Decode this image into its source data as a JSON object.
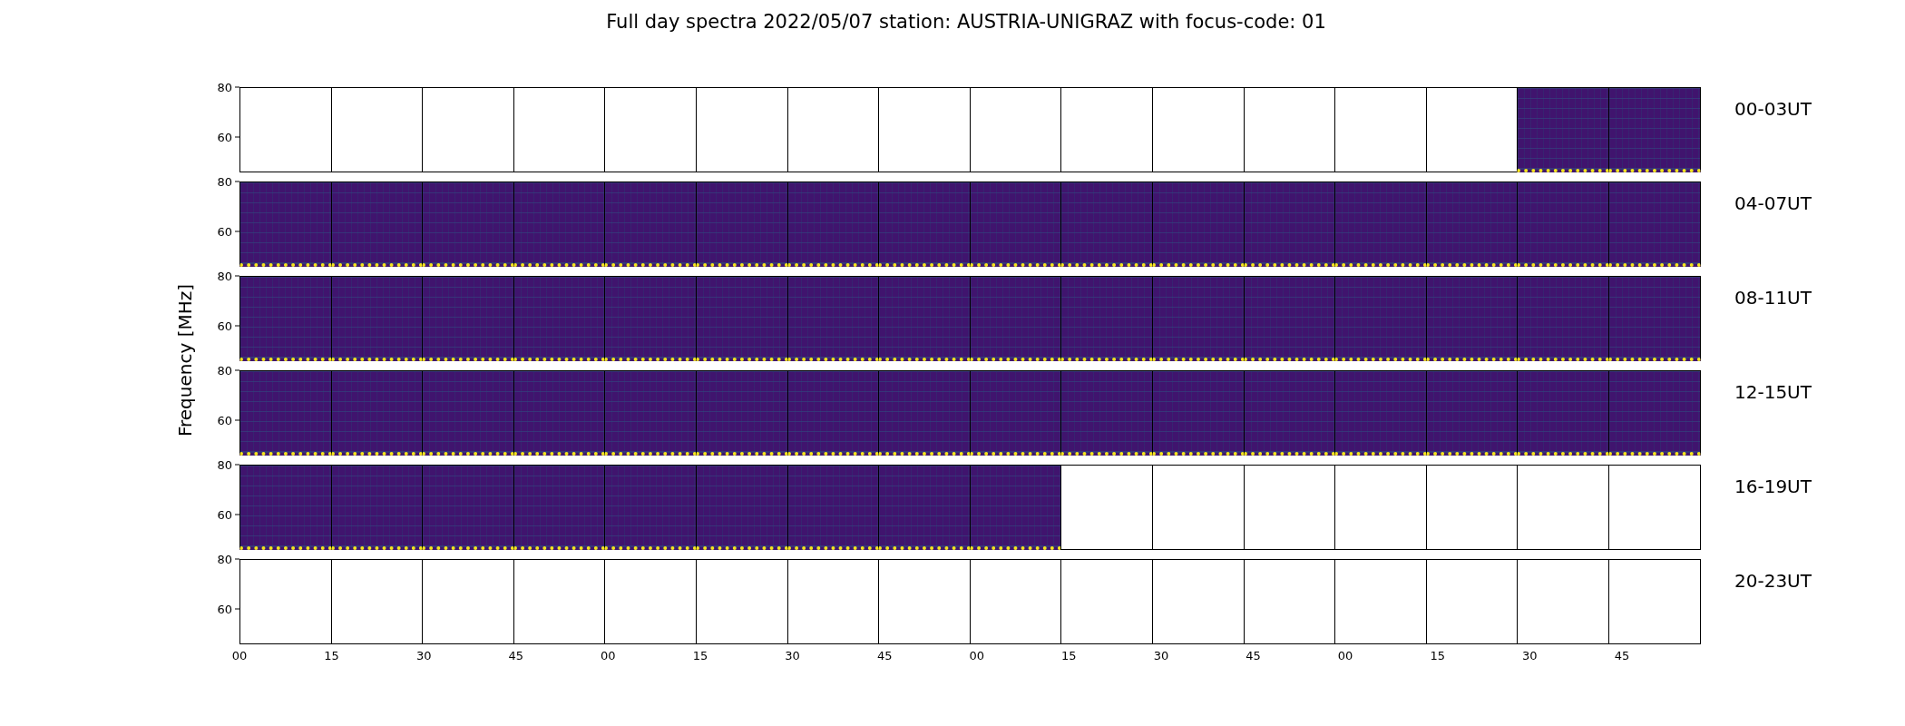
{
  "title": "Full day spectra 2022/05/07 station: AUSTRIA-UNIGRAZ with focus-code: 01",
  "y_axis_label": "Frequency [MHz]",
  "rows": [
    {
      "label": "00-03UT",
      "y_tick_labels": [
        "80",
        "60"
      ],
      "panels": [
        {
          "has_data": false
        },
        {
          "has_data": false
        },
        {
          "has_data": false
        },
        {
          "has_data": false
        },
        {
          "has_data": false
        },
        {
          "has_data": false
        },
        {
          "has_data": false
        },
        {
          "has_data": false
        },
        {
          "has_data": false
        },
        {
          "has_data": false
        },
        {
          "has_data": false
        },
        {
          "has_data": false
        },
        {
          "has_data": false
        },
        {
          "has_data": false
        },
        {
          "has_data": true
        },
        {
          "has_data": true
        }
      ]
    },
    {
      "label": "04-07UT",
      "y_tick_labels": [
        "80",
        "60"
      ],
      "panels": [
        {
          "has_data": true
        },
        {
          "has_data": true
        },
        {
          "has_data": true
        },
        {
          "has_data": true
        },
        {
          "has_data": true
        },
        {
          "has_data": true
        },
        {
          "has_data": true
        },
        {
          "has_data": true
        },
        {
          "has_data": true
        },
        {
          "has_data": true
        },
        {
          "has_data": true
        },
        {
          "has_data": true
        },
        {
          "has_data": true
        },
        {
          "has_data": true
        },
        {
          "has_data": true
        },
        {
          "has_data": true
        }
      ]
    },
    {
      "label": "08-11UT",
      "y_tick_labels": [
        "80",
        "60"
      ],
      "panels": [
        {
          "has_data": true
        },
        {
          "has_data": true
        },
        {
          "has_data": true
        },
        {
          "has_data": true
        },
        {
          "has_data": true
        },
        {
          "has_data": true
        },
        {
          "has_data": true
        },
        {
          "has_data": true
        },
        {
          "has_data": true
        },
        {
          "has_data": true
        },
        {
          "has_data": true
        },
        {
          "has_data": true
        },
        {
          "has_data": true
        },
        {
          "has_data": true
        },
        {
          "has_data": true
        },
        {
          "has_data": true
        }
      ]
    },
    {
      "label": "12-15UT",
      "y_tick_labels": [
        "80",
        "60"
      ],
      "panels": [
        {
          "has_data": true
        },
        {
          "has_data": true
        },
        {
          "has_data": true
        },
        {
          "has_data": true
        },
        {
          "has_data": true
        },
        {
          "has_data": true
        },
        {
          "has_data": true
        },
        {
          "has_data": true
        },
        {
          "has_data": true
        },
        {
          "has_data": true
        },
        {
          "has_data": true
        },
        {
          "has_data": true
        },
        {
          "has_data": true
        },
        {
          "has_data": true
        },
        {
          "has_data": true
        },
        {
          "has_data": true
        }
      ]
    },
    {
      "label": "16-19UT",
      "y_tick_labels": [
        "80",
        "60"
      ],
      "panels": [
        {
          "has_data": true
        },
        {
          "has_data": true
        },
        {
          "has_data": true
        },
        {
          "has_data": true
        },
        {
          "has_data": true
        },
        {
          "has_data": true
        },
        {
          "has_data": true
        },
        {
          "has_data": true
        },
        {
          "has_data": true
        },
        {
          "has_data": false
        },
        {
          "has_data": false
        },
        {
          "has_data": false
        },
        {
          "has_data": false
        },
        {
          "has_data": false
        },
        {
          "has_data": false
        },
        {
          "has_data": false
        }
      ]
    },
    {
      "label": "20-23UT",
      "y_tick_labels": [
        "80",
        "60"
      ],
      "panels": [
        {
          "has_data": false
        },
        {
          "has_data": false
        },
        {
          "has_data": false
        },
        {
          "has_data": false
        },
        {
          "has_data": false
        },
        {
          "has_data": false
        },
        {
          "has_data": false
        },
        {
          "has_data": false
        },
        {
          "has_data": false
        },
        {
          "has_data": false
        },
        {
          "has_data": false
        },
        {
          "has_data": false
        },
        {
          "has_data": false
        },
        {
          "has_data": false
        },
        {
          "has_data": false
        },
        {
          "has_data": false
        }
      ]
    }
  ],
  "x_tick_labels": [
    "00",
    "15",
    "30",
    "45",
    "00",
    "15",
    "30",
    "45",
    "00",
    "15",
    "30",
    "45",
    "00",
    "15",
    "30",
    "45"
  ]
}
